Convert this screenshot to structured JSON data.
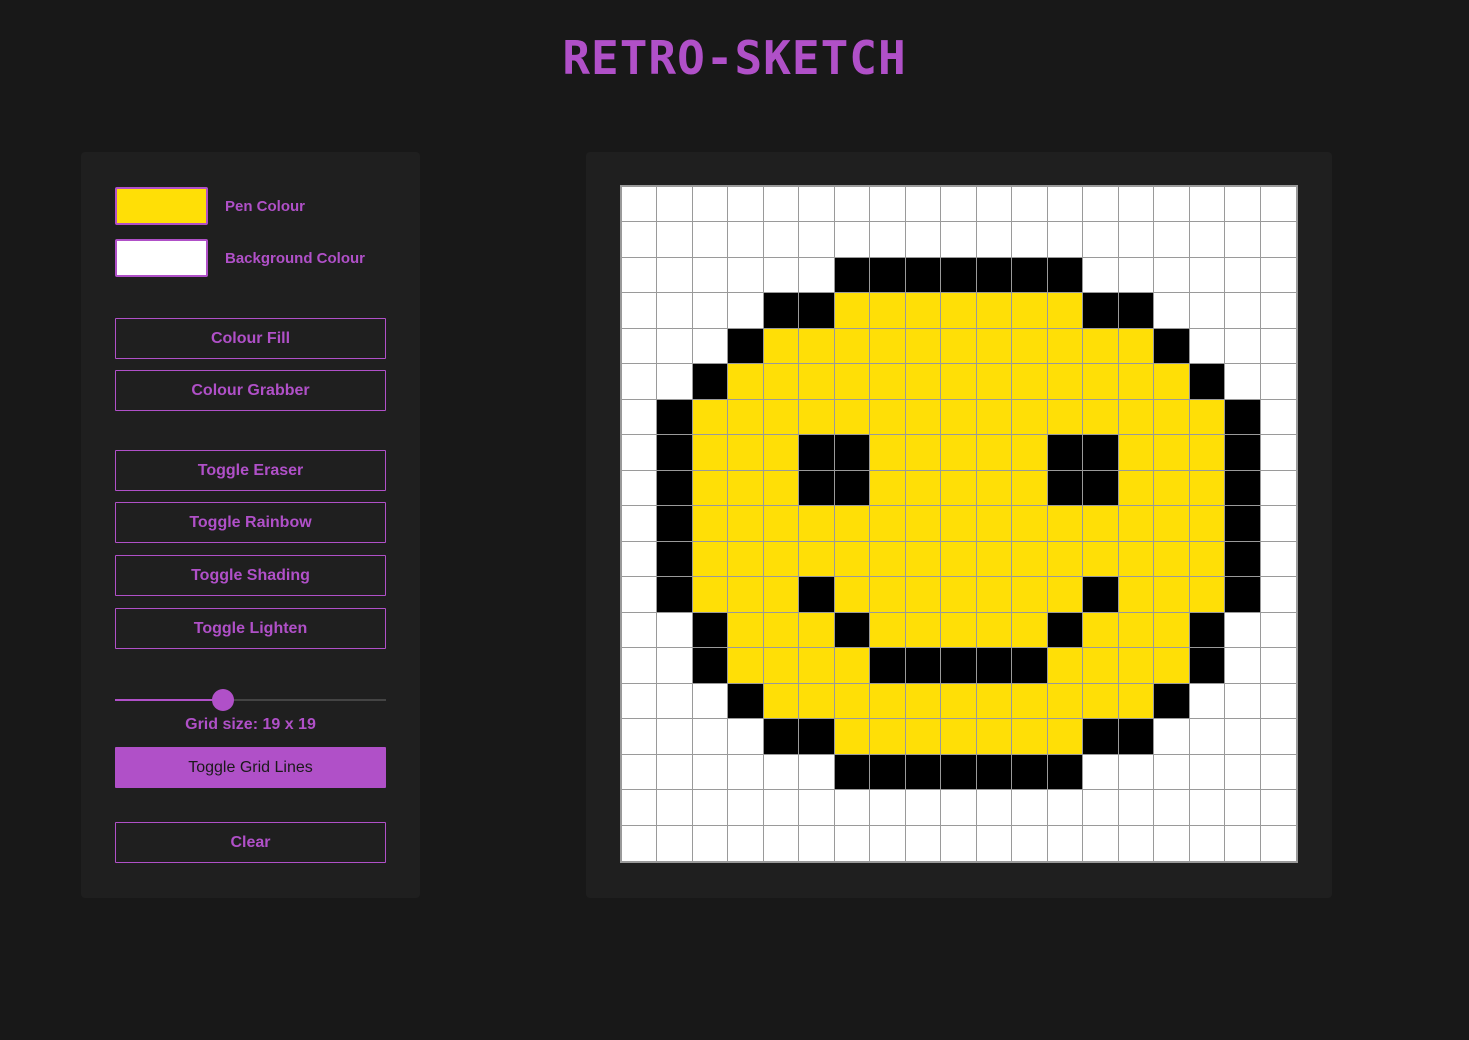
{
  "app": {
    "title": "RETRO-SKETCH"
  },
  "colors": {
    "accent": "#b050c8",
    "pen": "#ffdf06",
    "background": "#ffffff",
    "outline": "#000000",
    "grid_line": "#9a9a9a"
  },
  "controls": {
    "pen_colour_label": "Pen Colour",
    "background_colour_label": "Background Colour",
    "colour_fill_label": "Colour Fill",
    "colour_grabber_label": "Colour Grabber",
    "toggle_eraser_label": "Toggle Eraser",
    "toggle_rainbow_label": "Toggle Rainbow",
    "toggle_shading_label": "Toggle Shading",
    "toggle_lighten_label": "Toggle Lighten",
    "grid_size_text": "Grid size: 19 x 19",
    "grid_size_value": 19,
    "slider_min": 0,
    "slider_max": 60,
    "toggle_grid_lines_label": "Toggle Grid Lines",
    "clear_label": "Clear"
  },
  "canvas": {
    "size": 19,
    "legend": {
      "w": "background",
      "y": "pen",
      "k": "outline"
    },
    "rows": [
      "wwwwwwwwwwwwwwwwwww",
      "wwwwwwwwwwwwwwwwwww",
      "wwwwwwkkkkkkkwwwwww",
      "wwwwkkyyyyyyykkwwww",
      "wwwkyyyyyyyyyyykwww",
      "wwkyyyyyyyyyyyyykww",
      "wkyyyyyyyyyyyyyyykw",
      "wkyyykkyyyyykkyyykw",
      "wkyyykkyyyyykkyyykw",
      "wkyyyyyyyyyyyyyyykw",
      "wkyyyyyyyyyyyyyyykw",
      "wkyyykyyyyyyykyyykw",
      "wwkyyykyyyyykyyykww",
      "wwkyyyykkkkkyyyykww",
      "wwwkyyyyyyyyyyykwww",
      "wwwwkkyyyyyyykkwwww",
      "wwwwwwkkkkkkkwwwwww",
      "wwwwwwwwwwwwwwwwwww",
      "wwwwwwwwwwwwwwwwwww"
    ]
  }
}
